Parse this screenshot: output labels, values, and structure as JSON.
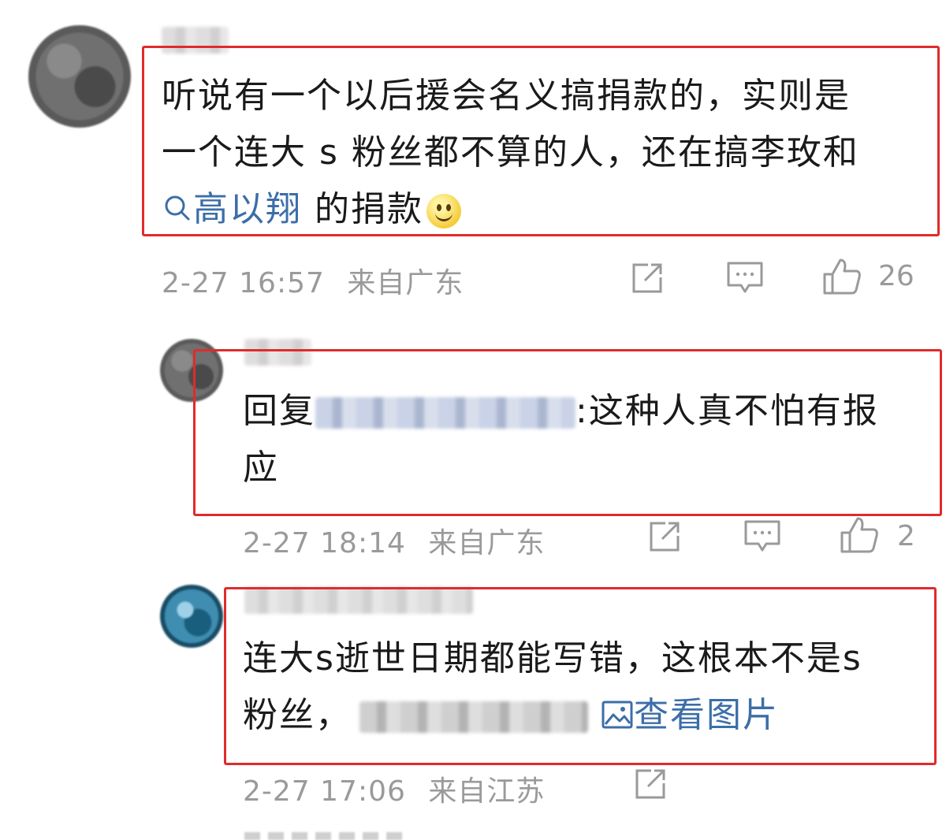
{
  "comments": [
    {
      "text_lines": [
        "听说有一个以后援会名义搞捐款的，实则是",
        "一个连大 s 粉丝都不算的人，还在搞李玫和"
      ],
      "link_text": "高以翔",
      "after_link": " 的捐款",
      "time": "2-27 16:57",
      "location": "来自广东",
      "likes": "26"
    },
    {
      "reply_prefix": "回复",
      "reply_suffix": ":这种人真不怕有报",
      "reply_line2": "应",
      "time": "2-27 18:14",
      "location": "来自广东",
      "likes": "2"
    },
    {
      "text_line1": "连大s逝世日期都能写错，这根本不是s",
      "text_line2": "粉丝，",
      "image_link": "查看图片",
      "time": "2-27 17:06",
      "location": "来自江苏"
    }
  ],
  "icons": [
    "share-icon",
    "comment-icon",
    "like-icon",
    "search-icon",
    "image-icon",
    "smile-emoji"
  ],
  "colors": {
    "highlight_border": "#e02b2b",
    "link": "#3c6ea8",
    "meta": "#9a9a9a"
  }
}
